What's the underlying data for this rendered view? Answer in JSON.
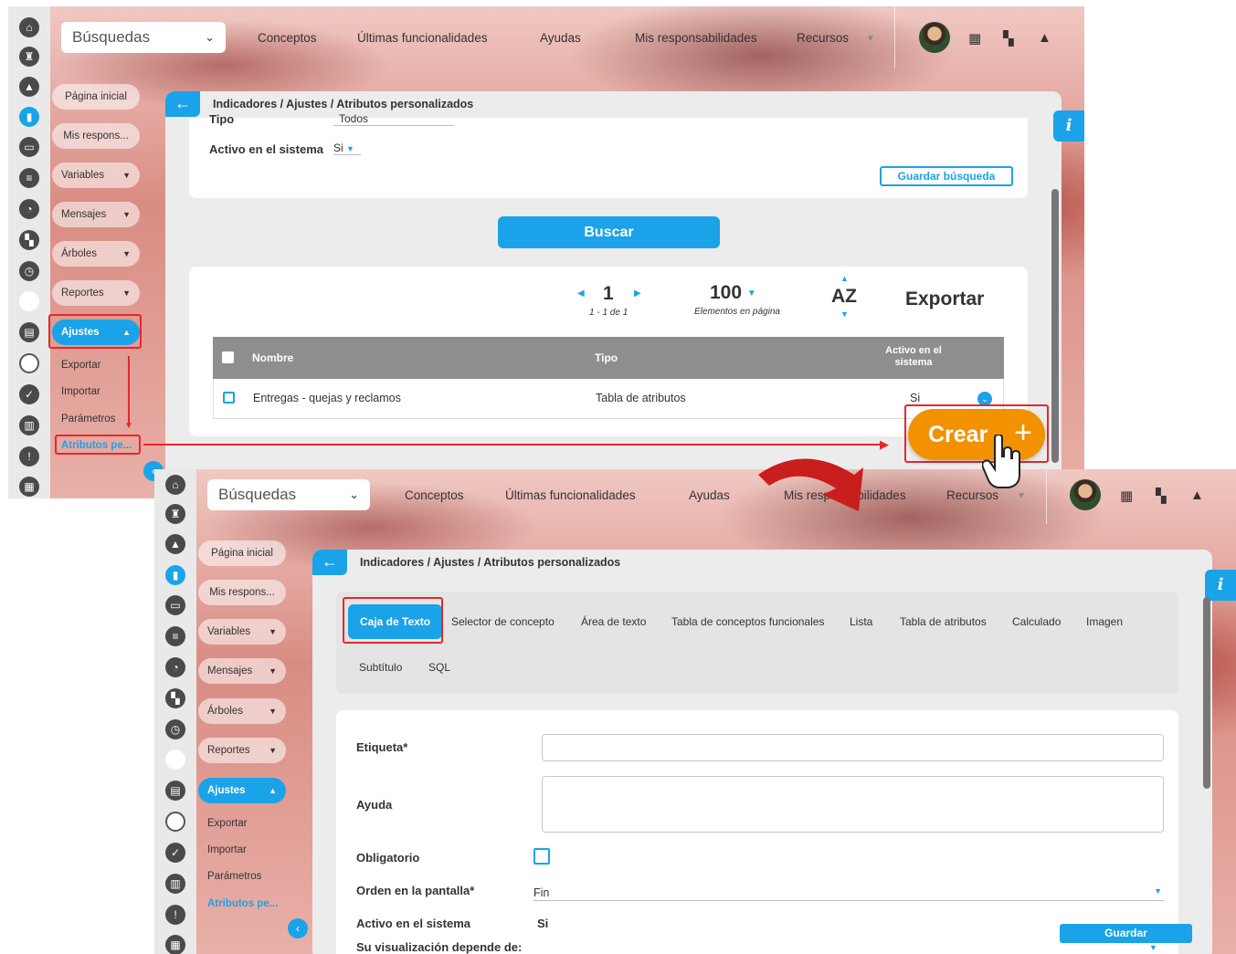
{
  "topbar": {
    "search_label": "Búsquedas",
    "nav": [
      "Conceptos",
      "Últimas funcionalidades",
      "Ayudas",
      "Mis responsabilidades",
      "Recursos"
    ]
  },
  "sidebar": {
    "home": "Página inicial",
    "responsibilities": "Mis respons...",
    "items": [
      "Variables",
      "Mensajes",
      "Árboles",
      "Reportes"
    ],
    "active_section": "Ajustes",
    "sub_items": [
      "Exportar",
      "Importar",
      "Parámetros",
      "Atributos pe..."
    ]
  },
  "breadcrumb": "Indicadores / Ajustes / Atributos personalizados",
  "search_panel": {
    "type_label": "Tipo",
    "type_value": "Todos",
    "active_label": "Activo en el sistema",
    "active_value": "Si",
    "save_search": "Guardar búsqueda",
    "search_button": "Buscar"
  },
  "pagination": {
    "page": "1",
    "range": "1 - 1 de 1",
    "per_page": "100",
    "per_page_label": "Elementos en página",
    "sort_label": "AZ",
    "export_label": "Exportar"
  },
  "table": {
    "columns": [
      "Nombre",
      "Tipo",
      "Activo en el sistema"
    ],
    "rows": [
      {
        "name": "Entregas - quejas y reclamos",
        "type": "Tabla de atributos",
        "active": "Si"
      }
    ]
  },
  "create_button": "Crear",
  "form_tabs": {
    "row1": [
      "Caja de Texto",
      "Selector de concepto",
      "Área de texto",
      "Tabla de conceptos funcionales",
      "Lista",
      "Tabla de atributos",
      "Calculado",
      "Imagen"
    ],
    "row2": [
      "Subtítulo",
      "SQL"
    ]
  },
  "form": {
    "label_field": "Etiqueta*",
    "help_field": "Ayuda",
    "required_field": "Obligatorio",
    "order_field": "Orden en la pantalla*",
    "order_value": "Fin",
    "active_field": "Activo en el sistema",
    "active_value": "Si",
    "depends_field": "Su visualización depende de:",
    "save_button": "Guardar"
  },
  "info_label": "i",
  "colors": {
    "accent": "#1aa3e8",
    "highlight": "#e8262a",
    "create": "#f39200"
  }
}
